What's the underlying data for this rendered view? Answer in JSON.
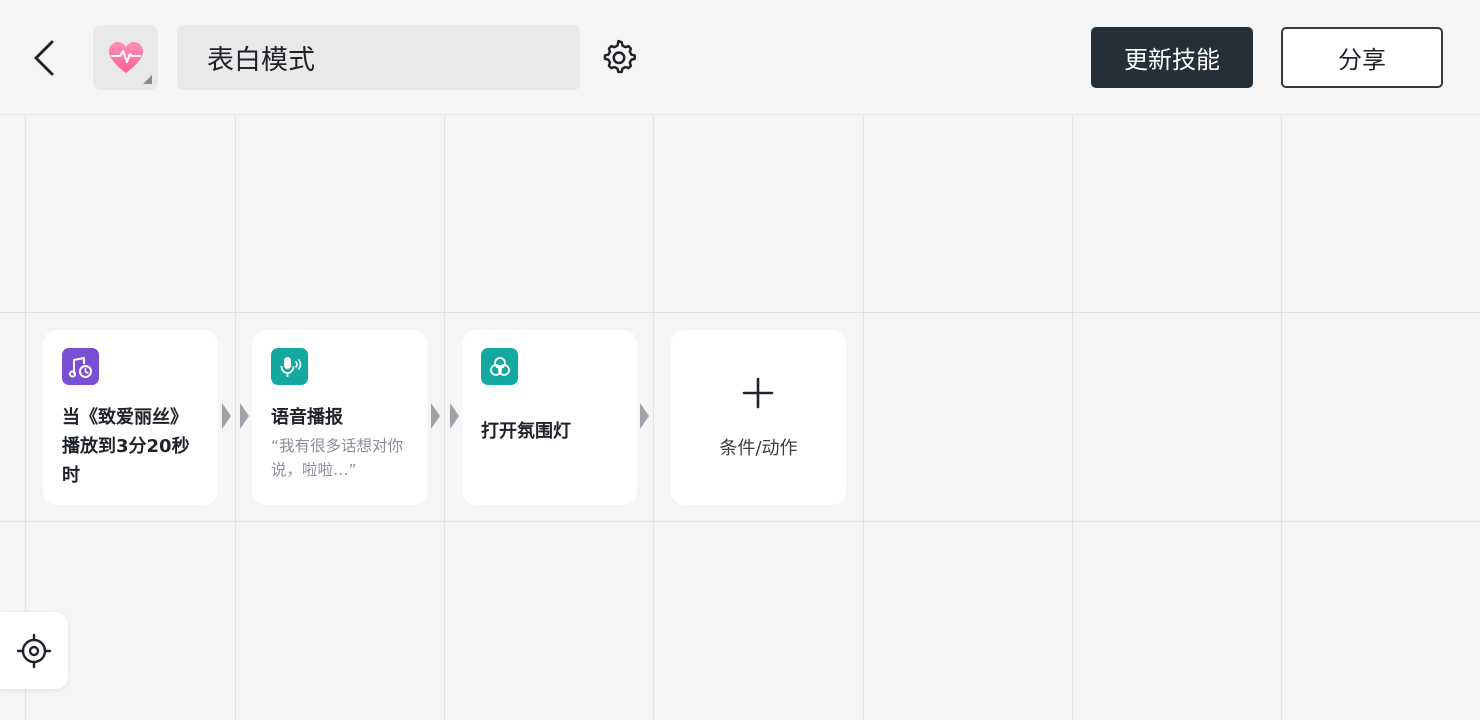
{
  "header": {
    "back_icon": "chevron-left-icon",
    "skill_icon": "heart-pulse-icon",
    "skill_name": "表白模式",
    "settings_icon": "gear-icon",
    "update_label": "更新技能",
    "share_label": "分享"
  },
  "flow": {
    "cards": [
      {
        "icon": "music-clock-icon",
        "icon_color": "#7a4fd6",
        "title": "当《致爱丽丝》播放到3分20秒时",
        "subtitle": ""
      },
      {
        "icon": "microphone-voice-icon",
        "icon_color": "#13a8a0",
        "title": "语音播报",
        "subtitle": "“我有很多话想对你说，啦啦…”"
      },
      {
        "icon": "ambient-light-icon",
        "icon_color": "#13a8a0",
        "title": "打开氛围灯",
        "subtitle": ""
      }
    ],
    "add_card": {
      "icon": "plus-icon",
      "label": "条件/动作"
    }
  },
  "locate_icon": "crosshair-icon",
  "colors": {
    "primary_dark": "#252f38",
    "background": "#f5f5f5",
    "card": "#ffffff"
  }
}
